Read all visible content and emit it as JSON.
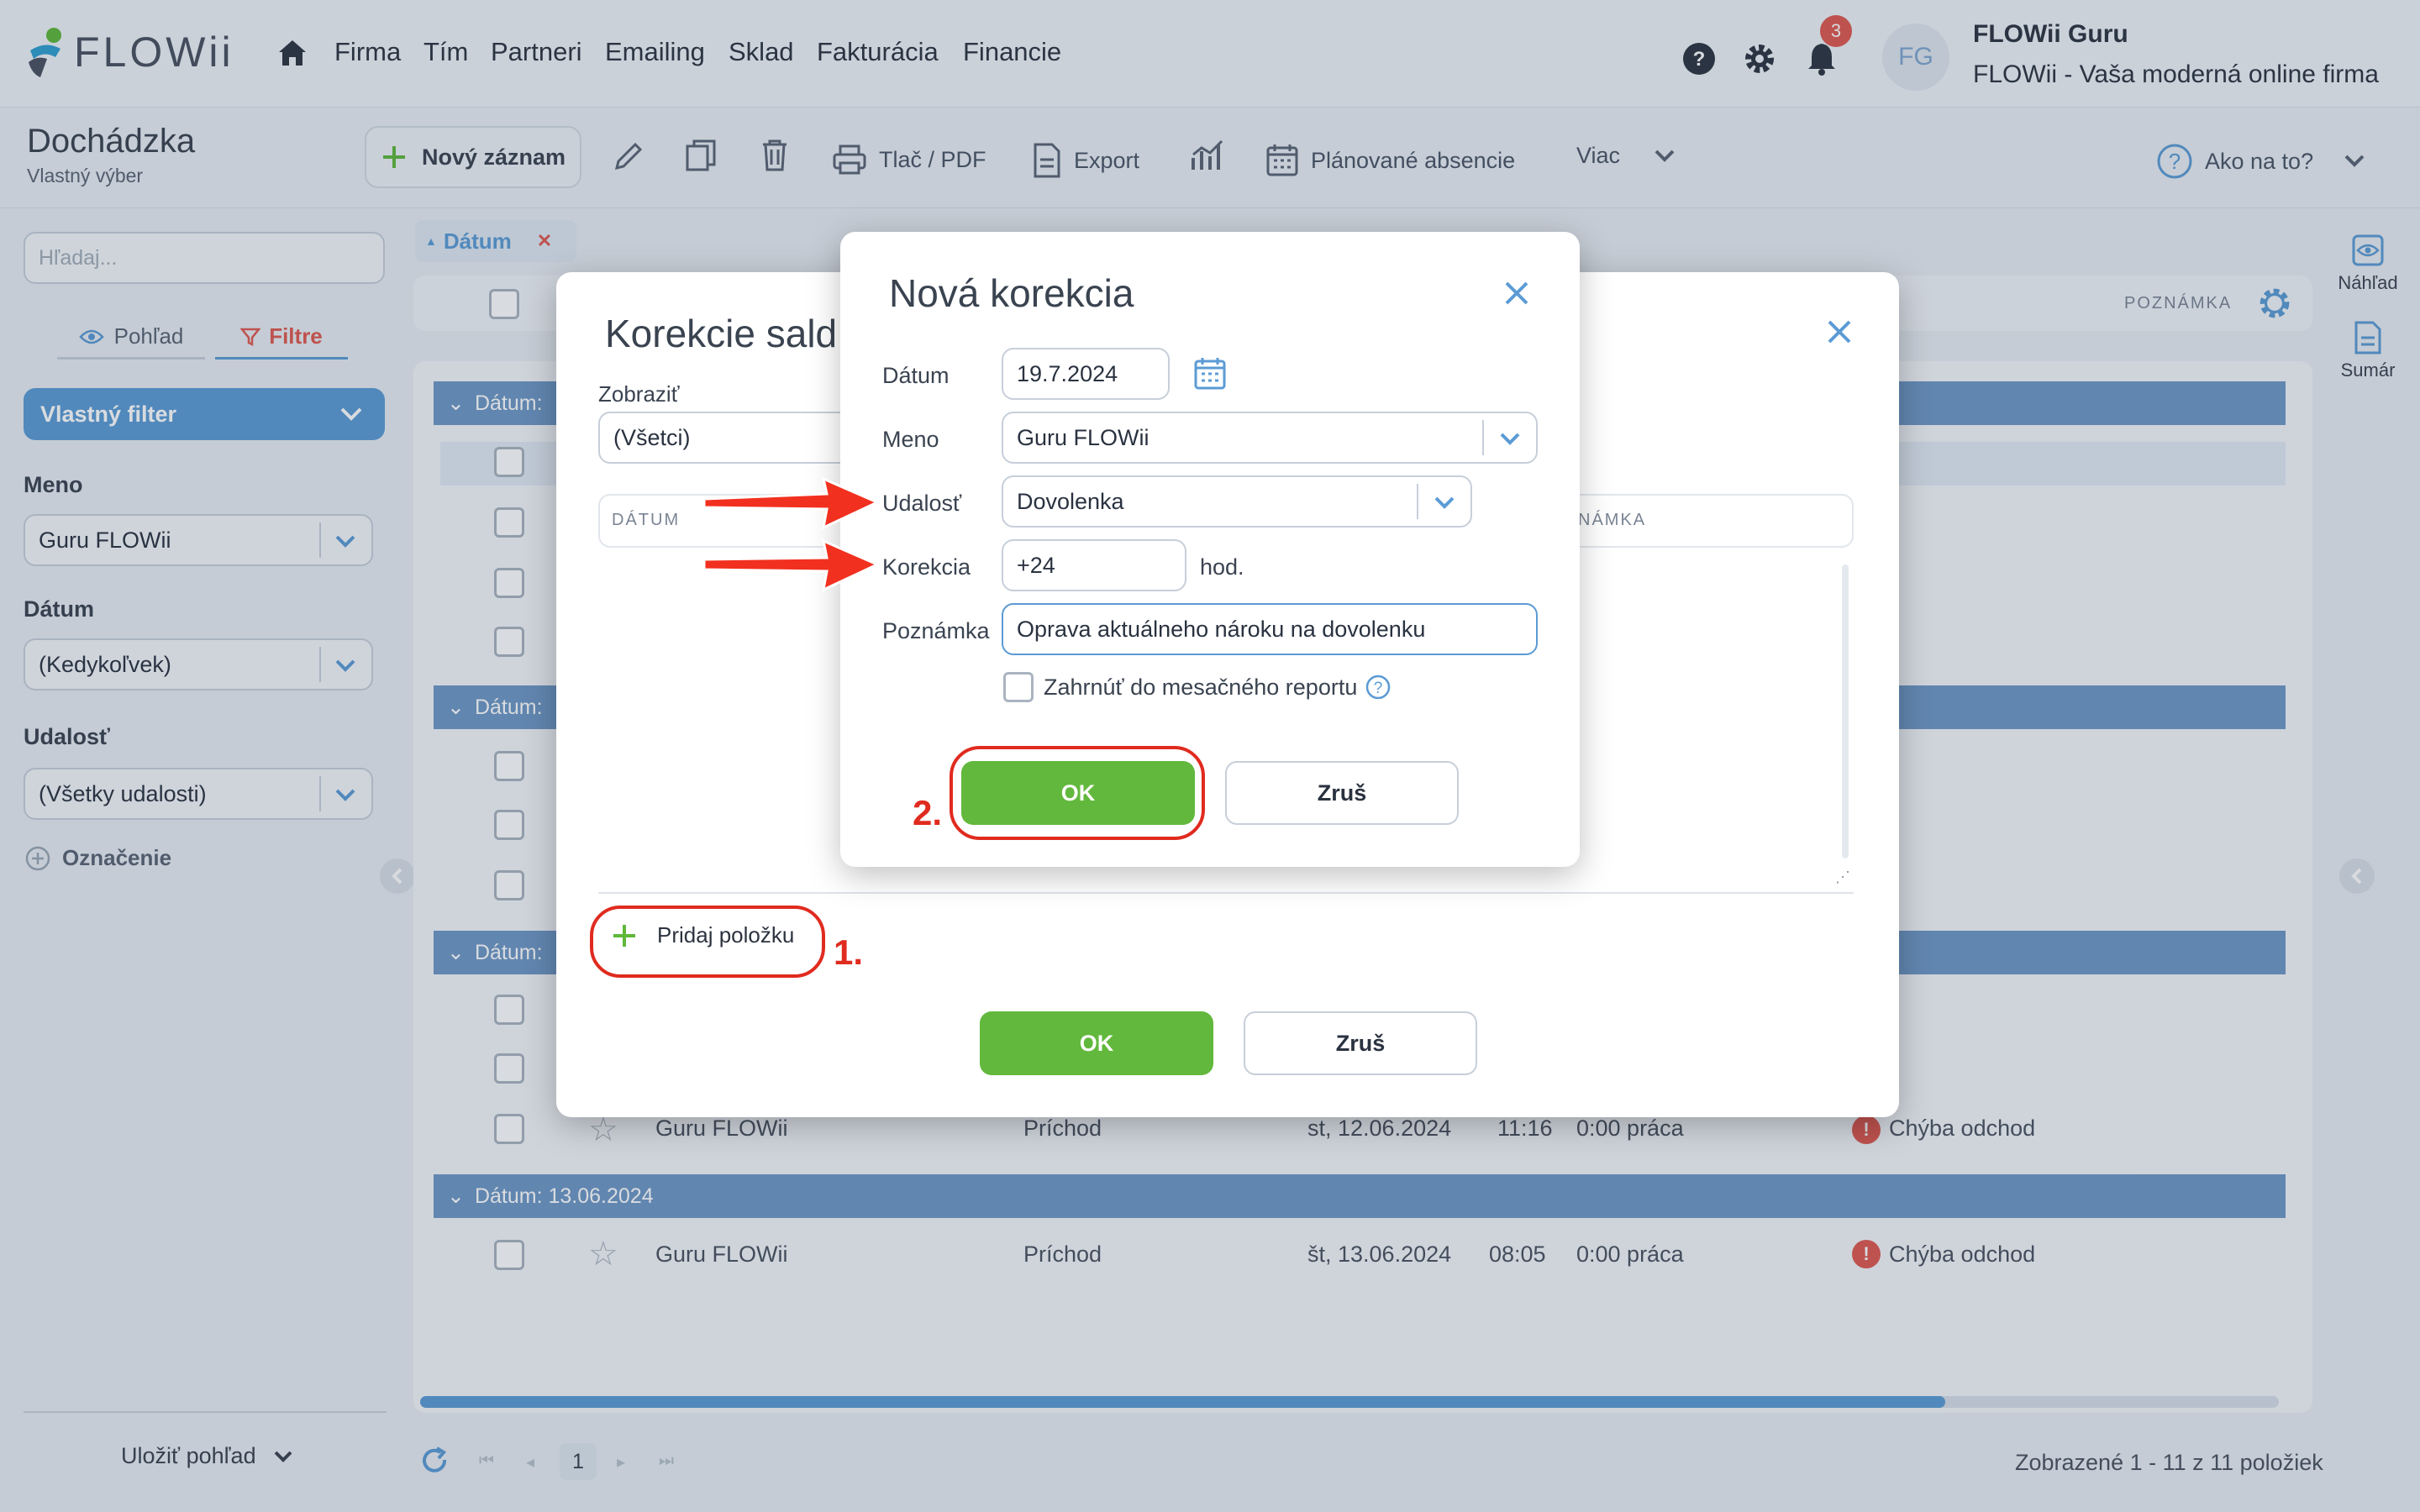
{
  "brand": {
    "name": "FLOWii"
  },
  "nav": {
    "items": [
      "Firma",
      "Tím",
      "Partneri",
      "Emailing",
      "Sklad",
      "Fakturácia",
      "Financie"
    ]
  },
  "user": {
    "initials": "FG",
    "name": "FLOWii Guru",
    "company": "FLOWii - Vaša moderná online firma",
    "notifications": "3"
  },
  "page": {
    "title": "Dochádzka",
    "subtitle": "Vlastný výber"
  },
  "toolbar": {
    "new": "Nový záznam",
    "print": "Tlač / PDF",
    "export": "Export",
    "planned": "Plánované absencie",
    "more": "Viac",
    "help": "Ako na to?"
  },
  "sidebar": {
    "search_placeholder": "Hľadaj...",
    "tab_view": "Pohľad",
    "tab_filters": "Filtre",
    "filter_select": "Vlastný filter",
    "meno_label": "Meno",
    "meno_value": "Guru FLOWii",
    "datum_label": "Dátum",
    "datum_value": "(Kedykoľvek)",
    "udalost_label": "Udalosť",
    "udalost_value": "(Všetky udalosti)",
    "oznacenie": "Označenie",
    "save_view": "Uložiť pohľad"
  },
  "grid": {
    "sort_chip": "Dátum",
    "column_note": "POZNÁMKA",
    "group_label": "Dátum:",
    "group_last": "Dátum: 13.06.2024",
    "rows": [
      {
        "name": "Guru FLOWii",
        "type": "Príchod",
        "date": "st, 12.06.2024",
        "time": "11:16",
        "work": "0:00 práca",
        "note": "Chýba odchod"
      },
      {
        "name": "Guru FLOWii",
        "type": "Príchod",
        "date": "št, 13.06.2024",
        "time": "08:05",
        "work": "0:00 práca",
        "note": "Chýba odchod"
      }
    ],
    "page": "1",
    "footer": "Zobrazené 1 - 11 z 11 položiek"
  },
  "right_panel": {
    "preview": "Náhľad",
    "summary": "Sumár"
  },
  "dialog_back": {
    "title": "Korekcie sald",
    "show_label": "Zobraziť",
    "show_value": "(Všetci)",
    "col_date": "DÁTUM",
    "col_note": "NÁMKA",
    "add_item": "Pridaj položku",
    "ok": "OK",
    "cancel": "Zruš"
  },
  "dialog_front": {
    "title": "Nová korekcia",
    "date_label": "Dátum",
    "date_value": "19.7.2024",
    "name_label": "Meno",
    "name_value": "Guru FLOWii",
    "event_label": "Udalosť",
    "event_value": "Dovolenka",
    "corr_label": "Korekcia",
    "corr_value": "+24",
    "corr_unit": "hod.",
    "note_label": "Poznámka",
    "note_value": "Oprava aktuálneho nároku na dovolenku",
    "include_label": "Zahrnúť do mesačného reportu",
    "ok": "OK",
    "cancel": "Zruš"
  },
  "annotations": {
    "step1": "1.",
    "step2": "2."
  }
}
